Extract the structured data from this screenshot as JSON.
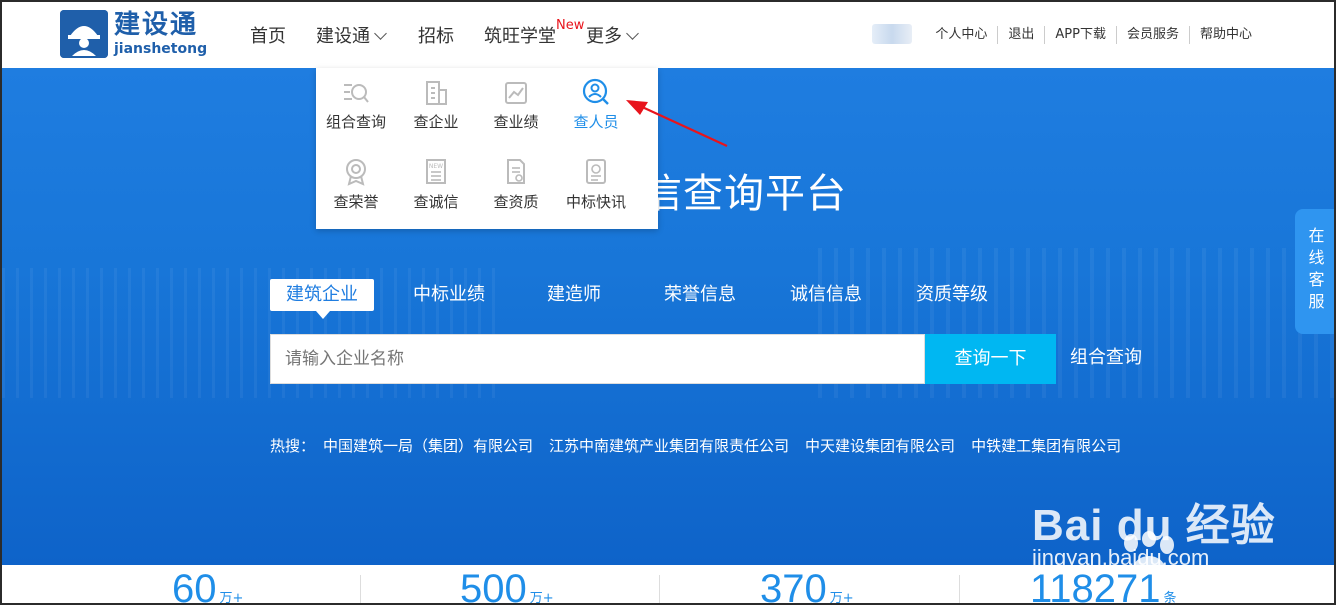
{
  "logo": {
    "cn": "建设通",
    "en": "jianshetong"
  },
  "nav": {
    "items": [
      {
        "label": "首页"
      },
      {
        "label": "建设通"
      },
      {
        "label": "招标"
      },
      {
        "label": "筑旺学堂"
      },
      {
        "label": "更多"
      }
    ],
    "new_badge": "New"
  },
  "user_nav": {
    "items": [
      "个人中心",
      "退出",
      "APP下载",
      "会员服务",
      "帮助中心"
    ]
  },
  "dropdown": {
    "items": [
      {
        "label": "组合查询",
        "icon": "combo-search-icon"
      },
      {
        "label": "查企业",
        "icon": "building-icon"
      },
      {
        "label": "查业绩",
        "icon": "chart-icon"
      },
      {
        "label": "查人员",
        "icon": "person-search-icon",
        "active": true
      },
      {
        "label": "查荣誉",
        "icon": "award-icon"
      },
      {
        "label": "查诚信",
        "icon": "newspaper-icon"
      },
      {
        "label": "查资质",
        "icon": "certificate-icon"
      },
      {
        "label": "中标快讯",
        "icon": "bid-news-icon"
      }
    ]
  },
  "hero": {
    "title_visible": "信查询平台",
    "tabs": [
      "建筑企业",
      "中标业绩",
      "建造师",
      "荣誉信息",
      "诚信信息",
      "资质等级"
    ],
    "search_placeholder": "请输入企业名称",
    "search_button": "查询一下",
    "combo_link": "组合查询",
    "hot_label": "热搜：",
    "hot_links": [
      "中国建筑一局（集团）有限公司",
      "江苏中南建筑产业集团有限责任公司",
      "中天建设集团有限公司",
      "中铁建工集团有限公司"
    ]
  },
  "side_service": {
    "chars": [
      "在",
      "线",
      "客",
      "服"
    ]
  },
  "stats": [
    {
      "num": "60",
      "unit": "万+"
    },
    {
      "num": "500",
      "unit": "万+"
    },
    {
      "num": "370",
      "unit": "万+"
    },
    {
      "num": "118271",
      "unit": "条"
    }
  ],
  "watermark": {
    "brand": "Bai du 经验",
    "url": "jingyan.baidu.com"
  },
  "colors": {
    "primary_blue": "#1f7de0",
    "accent_cyan": "#00b7f2",
    "logo_blue": "#1f5faa",
    "new_red": "#e8141c",
    "annotation_red": "#e8141c"
  }
}
